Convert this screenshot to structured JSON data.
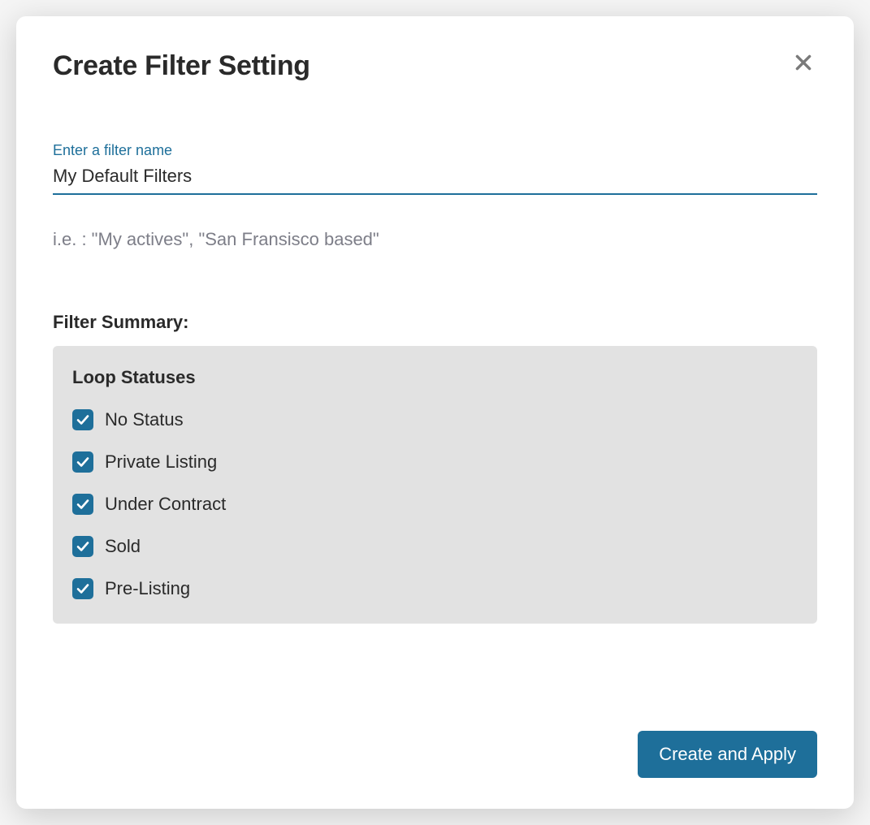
{
  "modal": {
    "title": "Create Filter Setting",
    "input_label": "Enter a filter name",
    "input_value": "My Default Filters",
    "hint": "i.e. : \"My actives\", \"San Fransisco based\"",
    "summary_label": "Filter Summary:",
    "summary_box": {
      "heading": "Loop Statuses",
      "items": [
        {
          "label": "No Status",
          "checked": true
        },
        {
          "label": "Private Listing",
          "checked": true
        },
        {
          "label": "Under Contract",
          "checked": true
        },
        {
          "label": "Sold",
          "checked": true
        },
        {
          "label": "Pre-Listing",
          "checked": true
        }
      ]
    },
    "apply_button": "Create and Apply"
  },
  "colors": {
    "accent": "#1e6f9a",
    "text": "#2a2a2a",
    "muted": "#7d7e88",
    "panel": "#e2e2e2"
  }
}
